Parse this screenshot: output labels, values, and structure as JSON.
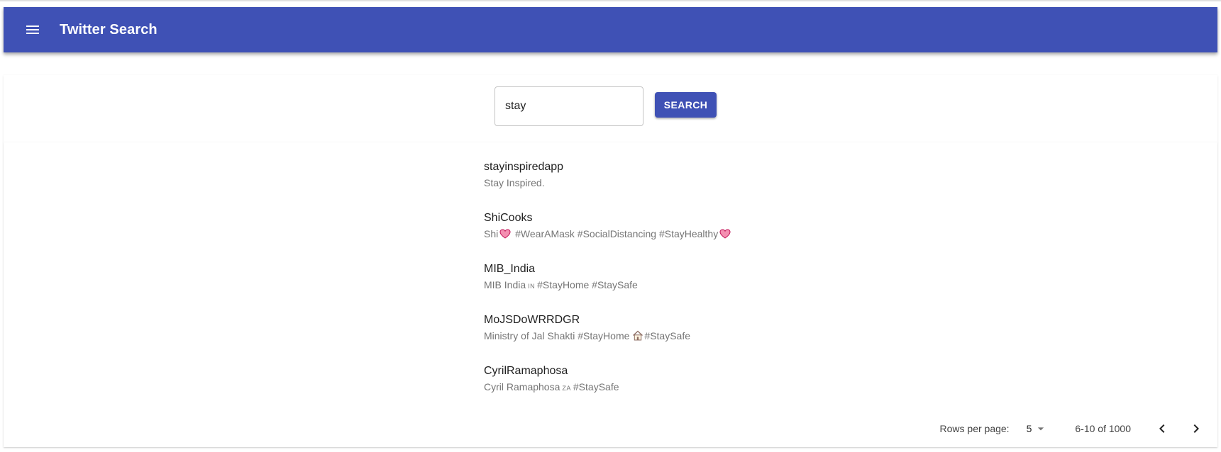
{
  "appbar": {
    "title": "Twitter Search",
    "menu_icon": "hamburger-menu-icon",
    "color": "#3f51b5"
  },
  "search": {
    "value": "stay",
    "button_label": "SEARCH"
  },
  "results": [
    {
      "name": "stayinspiredapp",
      "description": "Stay Inspired."
    },
    {
      "name": "ShiCooks",
      "description_parts": [
        "Shi",
        "#WearAMask #SocialDistancing #StayHealthy"
      ]
    },
    {
      "name": "MIB_India",
      "description_parts": [
        "MIB India",
        "IN",
        "#StayHome #StaySafe"
      ]
    },
    {
      "name": "MoJSDoWRRDGR",
      "description_parts": [
        "Ministry of Jal Shakti #StayHome",
        "#StaySafe"
      ]
    },
    {
      "name": "CyrilRamaphosa",
      "description_parts": [
        "Cyril Ramaphosa",
        "ZA",
        "#StaySafe"
      ]
    }
  ],
  "pagination": {
    "rows_label": "Rows per page:",
    "rows_value": "5",
    "range": "6-10 of 1000"
  }
}
